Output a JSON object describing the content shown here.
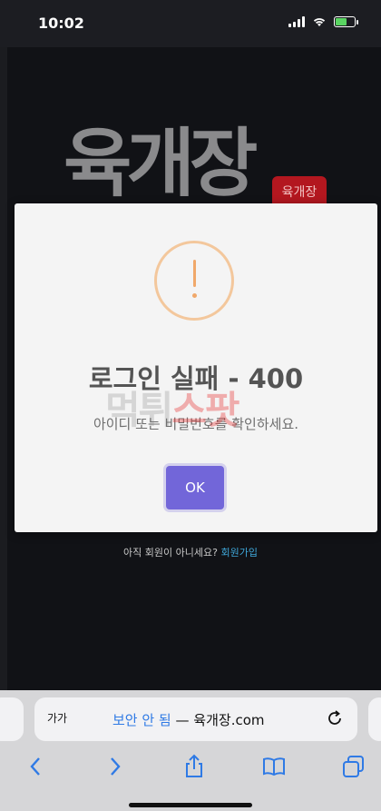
{
  "status": {
    "time": "10:02"
  },
  "page": {
    "logo_text": "육개장",
    "logo_stamp": "육개장",
    "signup_prompt": "아직 회원이 아니세요?",
    "signup_link": "회원가입"
  },
  "dialog": {
    "icon": "warning-icon",
    "title": "로그인 실패 - 400",
    "message": "아이디 또는 비밀번호를 확인하세요.",
    "ok_label": "OK",
    "accent_color": "#7266d9"
  },
  "watermark": {
    "text_grey": "먹튀",
    "text_red": "스팟"
  },
  "browser": {
    "text_size_label": "가가",
    "security_label": "보안 안 됨",
    "separator": " — ",
    "domain": "육개장.com"
  }
}
